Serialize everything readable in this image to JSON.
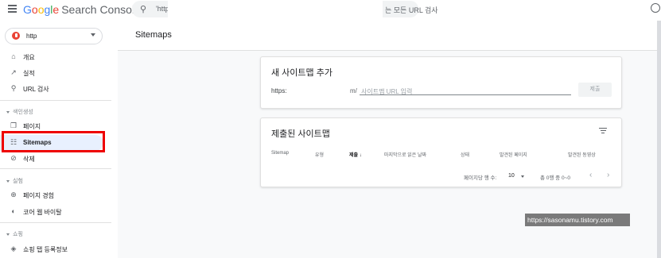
{
  "header": {
    "app_name_google": [
      "G",
      "o",
      "o",
      "g",
      "l",
      "e"
    ],
    "app_name_suffix": "Search Console",
    "search_prefix": "'http",
    "search_suffix": "는 모든 URL 검사"
  },
  "sidebar": {
    "property": "http",
    "items": [
      {
        "label": "개요",
        "icon": "home-icon"
      },
      {
        "label": "실적",
        "icon": "trending-icon"
      },
      {
        "label": "URL 검사",
        "icon": "search-icon"
      }
    ],
    "index_section": "색인생성",
    "index_items": [
      {
        "label": "페이지",
        "icon": "pages-icon"
      },
      {
        "label": "Sitemaps",
        "icon": "sitemap-icon"
      },
      {
        "label": "삭제",
        "icon": "removal-icon"
      }
    ],
    "experience_section": "실험",
    "experience_items": [
      {
        "label": "페이지 경험",
        "icon": "plus-circle-icon"
      },
      {
        "label": "코어 웹 바이탈",
        "icon": "gauge-icon"
      }
    ],
    "shopping_section": "쇼핑",
    "shopping_items": [
      {
        "label": "쇼핑 탭 등록정보",
        "icon": "tag-icon"
      }
    ]
  },
  "main": {
    "page_title": "Sitemaps",
    "add_card": {
      "title": "새 사이트맵 추가",
      "url_prefix": "https:",
      "url_mid": "m/",
      "input_placeholder": "사이트맵 URL 입력",
      "submit_label": "제출"
    },
    "submitted_card": {
      "title": "제출된 사이트맵",
      "columns": [
        "Sitemap",
        "유형",
        "제출",
        "마지막으로 읽은 날짜",
        "상태",
        "발견된 페이지",
        "발견된 동영상"
      ],
      "rows_per_page_label": "페이지당 행 수:",
      "rows_per_page": "10",
      "range": "총 0행 중 0~0"
    }
  },
  "watermark": "https://sasonamu.tistory.com",
  "colors": {
    "accent": "#1a73e8",
    "active_bg": "#e8f0fe",
    "highlight": "#ee0000"
  }
}
